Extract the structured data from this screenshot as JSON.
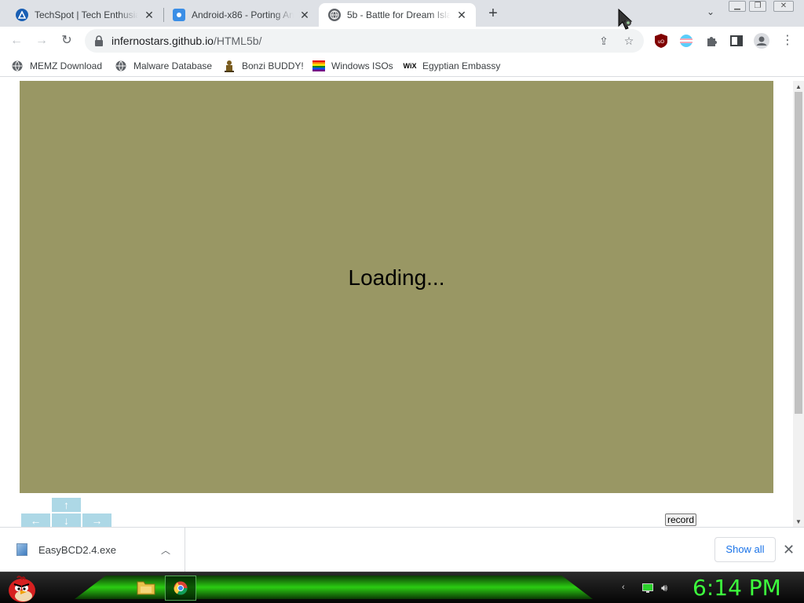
{
  "browser": {
    "tabs": [
      {
        "title": "TechSpot | Tech Enthusiasts",
        "active": false,
        "favicon": "techspot-icon"
      },
      {
        "title": "Android-x86 - Porting Android",
        "active": false,
        "favicon": "android-x86-icon"
      },
      {
        "title": "5b - Battle for Dream Island",
        "active": true,
        "favicon": "globe-icon"
      }
    ],
    "url_host": "infernostars.github.io",
    "url_path": "/HTML5b/",
    "bookmarks": [
      {
        "label": "MEMZ Download",
        "icon": "globe-icon"
      },
      {
        "label": "Malware Database",
        "icon": "globe-icon"
      },
      {
        "label": "Bonzi BUDDY!",
        "icon": "bonzi-icon"
      },
      {
        "label": "Windows ISOs",
        "icon": "rainbow-flag-icon"
      },
      {
        "label": "Egyptian Embassy",
        "icon": "wix-icon"
      }
    ]
  },
  "page": {
    "loading_text": "Loading...",
    "controls": {
      "up": "↑",
      "left": "←",
      "down": "↓",
      "right": "→"
    },
    "record_label": "record",
    "canvas_color": "#999764"
  },
  "downloads": {
    "file_name": "EasyBCD2.4.exe",
    "show_all_label": "Show all"
  },
  "taskbar": {
    "clock": "6:14 PM"
  },
  "colors": {
    "link_blue": "#1a73e8",
    "clock_green": "#3dff3d"
  }
}
